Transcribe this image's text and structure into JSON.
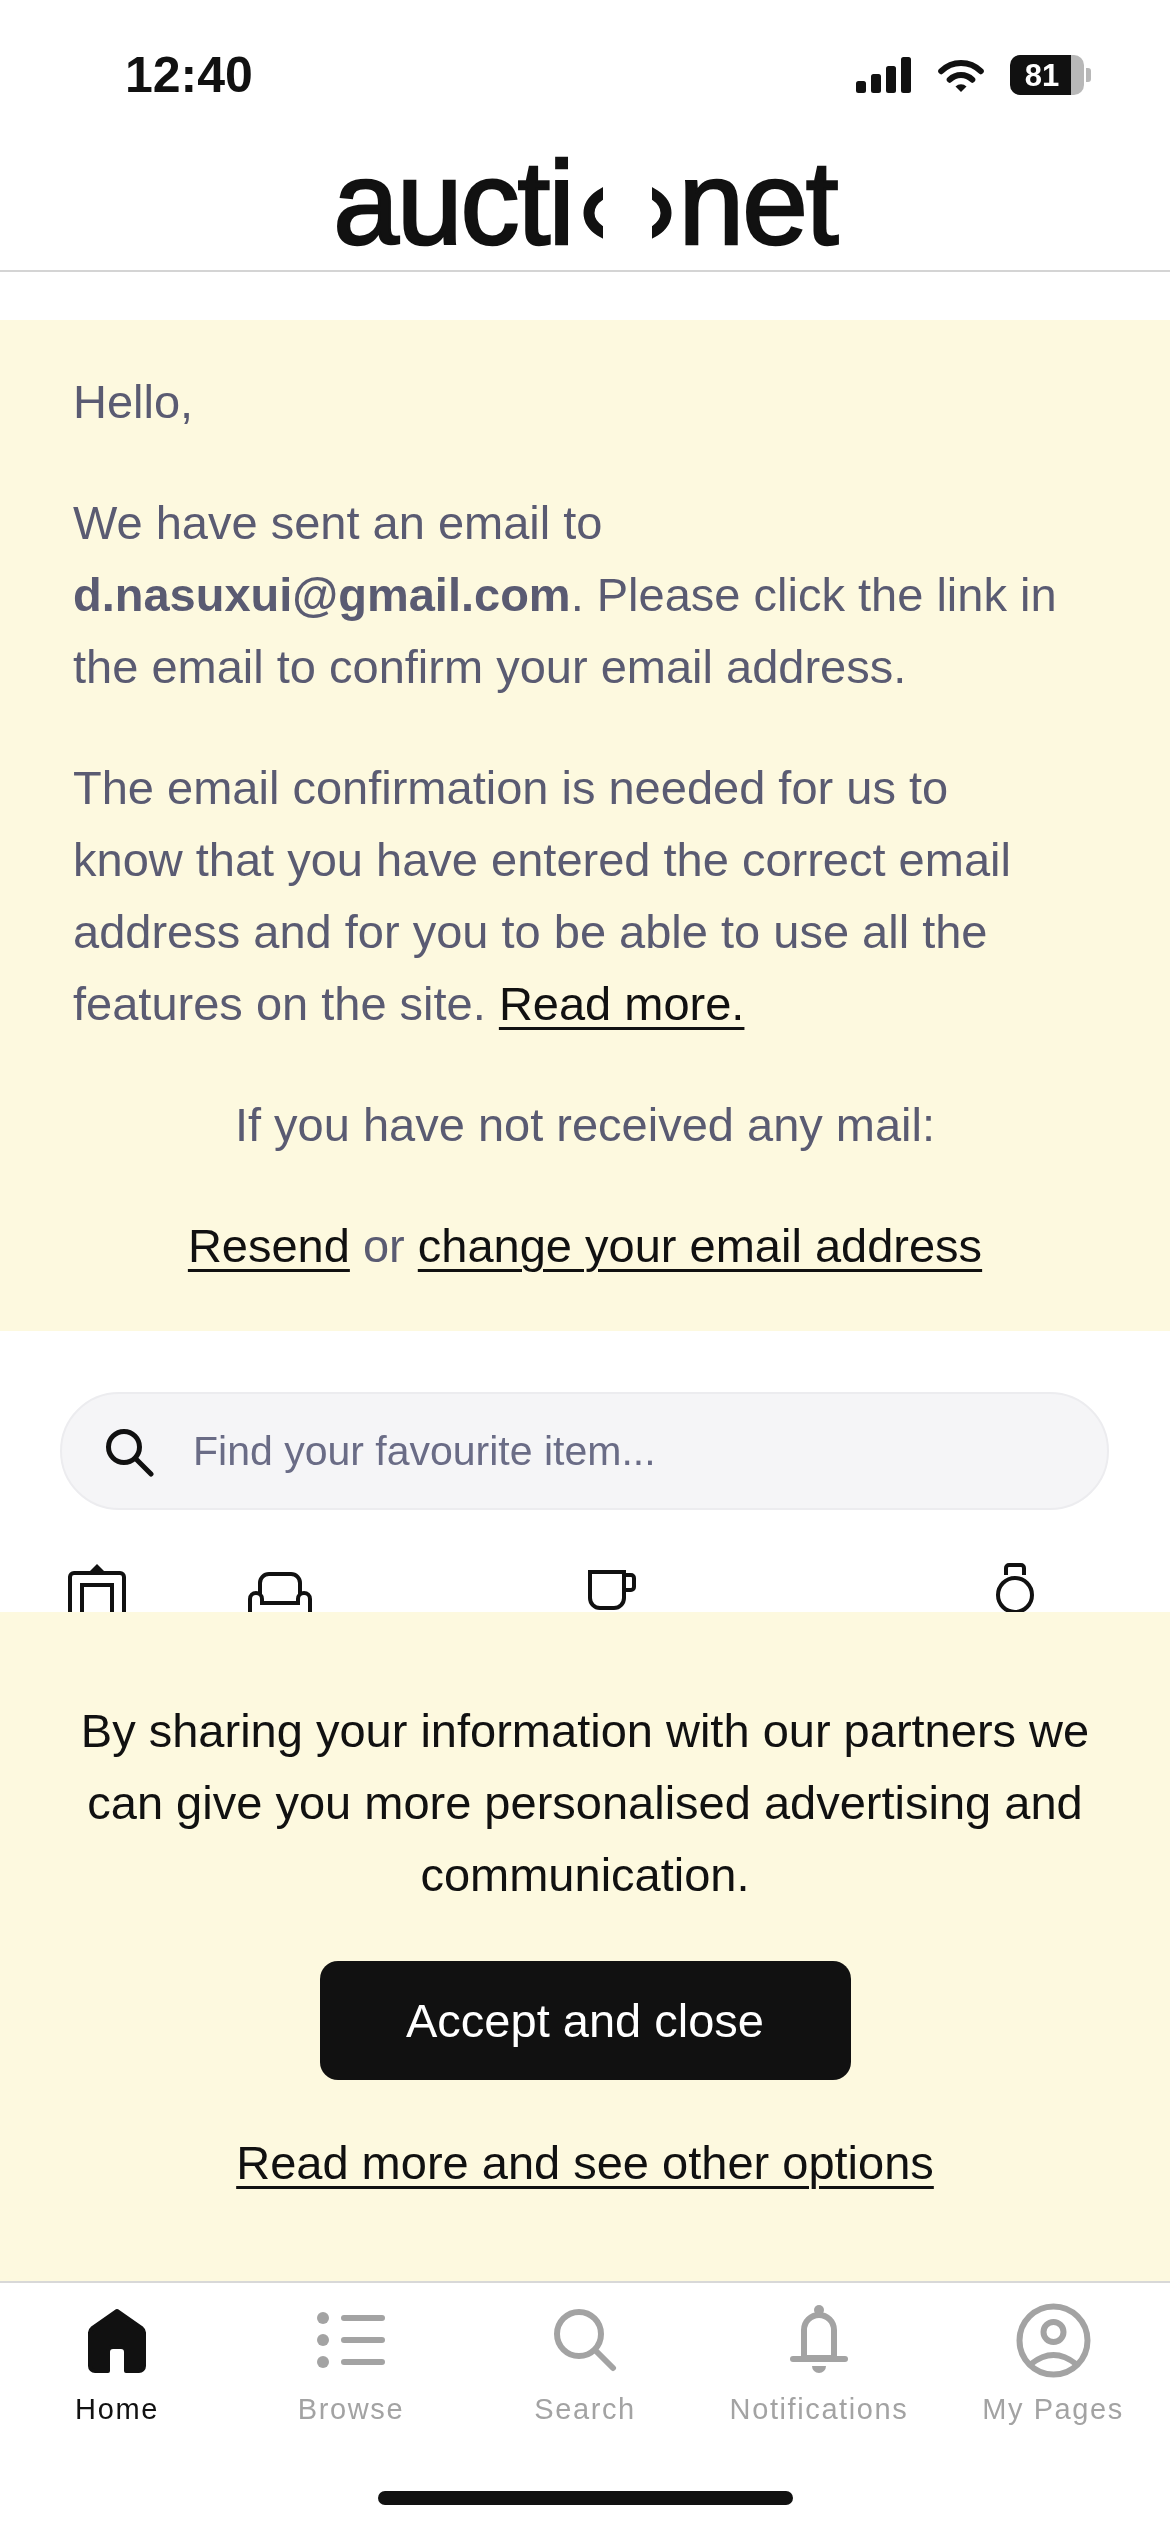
{
  "status_bar": {
    "time": "12:40",
    "battery": "81"
  },
  "logo": {
    "prefix": "aucti",
    "suffix": "net"
  },
  "notice": {
    "greeting": "Hello,",
    "message": "We have sent an email to **d.nasuxui@gmail.com**. Please click the link in the email to confirm your email address.",
    "explanation": "The email confirmation is needed for us to know that you have entered the correct email address and for you to be able to use all the features on the site.",
    "read_more_link": "Read more.",
    "not_received": "If you have not received any mail:",
    "resend_link": "Resend",
    "separator": "or",
    "change_email_link": "change your email address"
  },
  "search": {
    "placeholder": "Find your favourite item..."
  },
  "cookie_banner": {
    "text": "By sharing your information with our partners we can give you more personalised advertising and communication.",
    "accept_button": "Accept and close",
    "options_link": "Read more and see other options"
  },
  "tab_bar": [
    {
      "label": "Home",
      "selected": true
    },
    {
      "label": "Browse",
      "selected": false
    },
    {
      "label": "Search",
      "selected": false
    },
    {
      "label": "Notifications",
      "selected": false
    },
    {
      "label": "My Pages",
      "selected": false
    }
  ]
}
